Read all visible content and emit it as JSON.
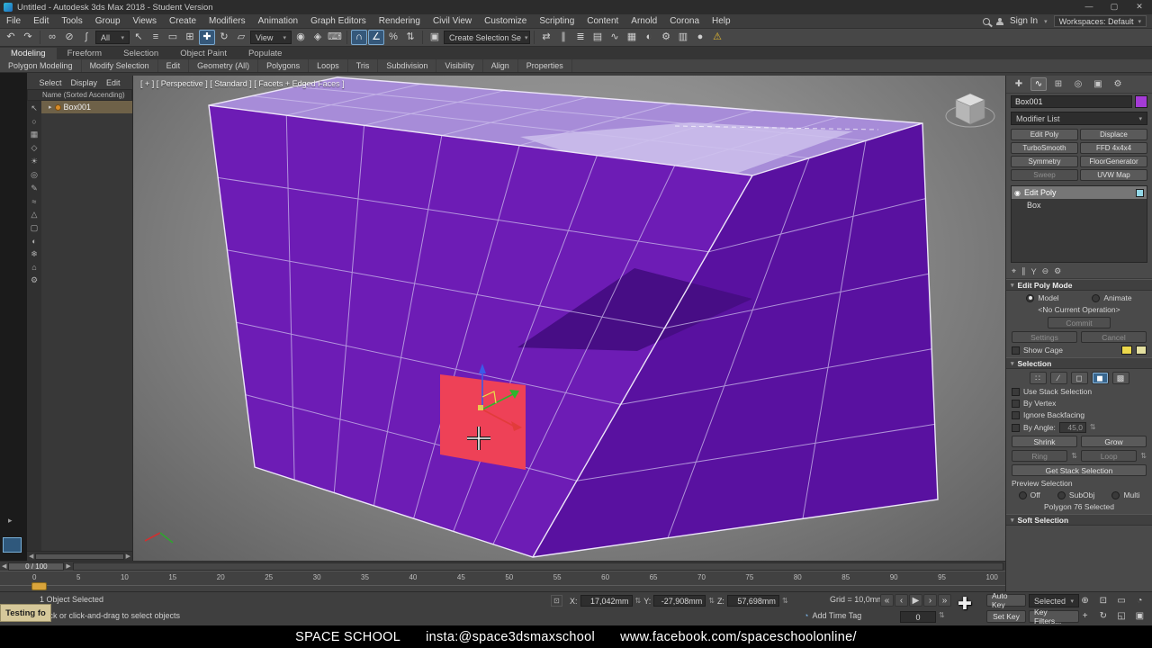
{
  "colors": {
    "box_front": "#6d1cb5",
    "box_side": "#5911a0",
    "box_top": "#a78cd8",
    "selected_polygon": "#ee4157",
    "highlight_blue": "#35587a",
    "object_swatch": "#a43bd6",
    "playhead_yellow": "#d9a43b"
  },
  "ui_glyphs": {
    "dropdown_arrow": "▾",
    "expander": "▸",
    "spinner": "⇅",
    "arrow_left": "◀",
    "arrow_right": "▶"
  },
  "title_bar": {
    "title": "Untitled - Autodesk 3ds Max 2018 - Student Version",
    "window_controls": [
      {
        "name": "minimize-button",
        "glyph": "—"
      },
      {
        "name": "maximize-button",
        "glyph": "▢"
      },
      {
        "name": "close-button",
        "glyph": "✕"
      }
    ]
  },
  "menu_bar": {
    "items": [
      "File",
      "Edit",
      "Tools",
      "Group",
      "Views",
      "Create",
      "Modifiers",
      "Animation",
      "Graph Editors",
      "Rendering",
      "Civil View",
      "Customize",
      "Scripting",
      "Content",
      "Arnold",
      "Corona",
      "Help"
    ],
    "sign_in": "Sign In",
    "workspaces": "Workspaces: Default"
  },
  "toolbar": {
    "history_icons": [
      {
        "name": "undo-icon",
        "glyph": "↶"
      },
      {
        "name": "redo-icon",
        "glyph": "↷"
      }
    ],
    "link_icons": [
      {
        "name": "select-and-link-icon",
        "glyph": "∞"
      },
      {
        "name": "unlink-selection-icon",
        "glyph": "⊘"
      },
      {
        "name": "bind-to-space-warp-icon",
        "glyph": "∫"
      }
    ],
    "selection_filter": "All",
    "select_icons": [
      {
        "name": "select-object-icon",
        "glyph": "↖"
      },
      {
        "name": "select-by-name-icon",
        "glyph": "≡"
      },
      {
        "name": "rectangular-selection-region-icon",
        "glyph": "▭"
      },
      {
        "name": "window-crossing-icon",
        "glyph": "⊞"
      }
    ],
    "transform_icons": [
      {
        "name": "select-and-move-icon",
        "glyph": "✚",
        "cls": "active"
      },
      {
        "name": "select-and-rotate-icon",
        "glyph": "↻"
      },
      {
        "name": "select-and-scale-icon",
        "glyph": "▱"
      }
    ],
    "ref_coord": "View",
    "pivot_icons": [
      {
        "name": "use-pivot-point-center-icon",
        "glyph": "◉"
      },
      {
        "name": "select-and-manipulate-icon",
        "glyph": "◈"
      },
      {
        "name": "keyboard-shortcut-override-icon",
        "glyph": "⌨"
      }
    ],
    "snap_icons": [
      {
        "name": "snaps-toggle-icon",
        "glyph": "∩",
        "cls": "active"
      },
      {
        "name": "angle-snap-icon",
        "glyph": "∠",
        "cls": "active"
      },
      {
        "name": "percent-snap-icon",
        "glyph": "%"
      },
      {
        "name": "spinner-snap-icon",
        "glyph": "⇅"
      }
    ],
    "named_set_icons": [
      {
        "name": "edit-named-selection-sets-icon",
        "glyph": "▣"
      }
    ],
    "selection_set_value": "Create Selection Se",
    "right_icons": [
      {
        "name": "mirror-icon",
        "glyph": "⇄"
      },
      {
        "name": "align-icon",
        "glyph": "∥"
      },
      {
        "name": "layer-manager-icon",
        "glyph": "≣"
      },
      {
        "name": "ribbon-toggle-icon",
        "glyph": "▤"
      },
      {
        "name": "curve-editor-icon",
        "glyph": "∿"
      },
      {
        "name": "schematic-view-icon",
        "glyph": "▦"
      },
      {
        "name": "material-editor-icon",
        "glyph": "◐"
      },
      {
        "name": "render-setup-icon",
        "glyph": "⚙"
      },
      {
        "name": "rendered-frame-window-icon",
        "glyph": "▥"
      },
      {
        "name": "render-production-icon",
        "glyph": "●"
      },
      {
        "name": "warning-icon",
        "glyph": "⚠",
        "cls": "warn"
      }
    ]
  },
  "ribbon": {
    "tabs": [
      {
        "label": "Modeling",
        "cls": "active"
      },
      {
        "label": "Freeform"
      },
      {
        "label": "Selection"
      },
      {
        "label": "Object Paint"
      },
      {
        "label": "Populate"
      }
    ],
    "sections": [
      "Polygon Modeling",
      "Modify Selection",
      "Edit",
      "Geometry (All)",
      "Polygons",
      "Loops",
      "Tris",
      "Subdivision",
      "Visibility",
      "Align",
      "Properties"
    ]
  },
  "scene_explorer": {
    "tabs": [
      {
        "name": "explorer-tab-select",
        "label": "Select"
      },
      {
        "name": "explorer-tab-display",
        "label": "Display"
      },
      {
        "name": "explorer-tab-edit",
        "label": "Edit"
      }
    ],
    "column_header": "Name (Sorted Ascending)",
    "left_icons": [
      {
        "name": "select-filter-icon",
        "glyph": "↖"
      },
      {
        "name": "display-all-icon",
        "glyph": "○"
      },
      {
        "name": "display-geometry-icon",
        "glyph": "▦"
      },
      {
        "name": "display-shapes-icon",
        "glyph": "◇"
      },
      {
        "name": "display-lights-icon",
        "glyph": "☀"
      },
      {
        "name": "display-cameras-icon",
        "glyph": "◎"
      },
      {
        "name": "display-helpers-icon",
        "glyph": "✎"
      },
      {
        "name": "display-spacewarps-icon",
        "glyph": "≈"
      },
      {
        "name": "display-bones-icon",
        "glyph": "△"
      },
      {
        "name": "display-containers-icon",
        "glyph": "▢"
      },
      {
        "name": "display-materials-icon",
        "glyph": "◐"
      },
      {
        "name": "display-frozen-icon",
        "glyph": "❄"
      },
      {
        "name": "display-hidden-icon",
        "glyph": "⌂"
      },
      {
        "name": "explorer-settings-icon",
        "glyph": "⚙"
      }
    ],
    "rows": [
      {
        "name": "Box001"
      }
    ]
  },
  "viewport": {
    "label": "[ + ] [ Perspective ] [ Standard ] [ Facets + Edged Faces ]"
  },
  "command_panel": {
    "tab_icons": [
      {
        "name": "create-tab-icon",
        "glyph": "✚"
      },
      {
        "name": "modify-tab-icon",
        "glyph": "∿",
        "cls": "active"
      },
      {
        "name": "hierarchy-tab-icon",
        "glyph": "⊞"
      },
      {
        "name": "motion-tab-icon",
        "glyph": "◎"
      },
      {
        "name": "display-tab-icon",
        "glyph": "▣"
      },
      {
        "name": "utilities-tab-icon",
        "glyph": "⚙"
      }
    ],
    "object_name": "Box001",
    "modifier_list_label": "Modifier List",
    "modifier_buttons": [
      {
        "name": "modifier-button-edit-poly",
        "label": "Edit Poly"
      },
      {
        "name": "modifier-button-displace",
        "label": "Displace"
      },
      {
        "name": "modifier-button-turbosmooth",
        "label": "TurboSmooth"
      },
      {
        "name": "modifier-button-ffd4x4x4",
        "label": "FFD 4x4x4"
      },
      {
        "name": "modifier-button-symmetry",
        "label": "Symmetry"
      },
      {
        "name": "modifier-button-floorgenerator",
        "label": "FloorGenerator"
      },
      {
        "name": "modifier-button-sweep",
        "label": "Sweep",
        "cls": "dim"
      },
      {
        "name": "modifier-button-uvw-map",
        "label": "UVW Map"
      }
    ],
    "stack_rows": [
      {
        "name": "Edit Poly",
        "icon": "◉"
      },
      {
        "name": "Box"
      }
    ],
    "stack_tool_icons": [
      {
        "name": "pin-stack-icon",
        "glyph": "⌖"
      },
      {
        "name": "show-end-result-icon",
        "glyph": "∥"
      },
      {
        "name": "make-unique-icon",
        "glyph": "Y"
      },
      {
        "name": "remove-modifier-icon",
        "glyph": "⊖"
      },
      {
        "name": "configure-modifier-sets-icon",
        "glyph": "⚙"
      }
    ],
    "edit_poly_mode": {
      "title": "Edit Poly Mode",
      "model_label": "Model",
      "animate_label": "Animate",
      "operation": "<No Current Operation>",
      "commit_label": "Commit",
      "settings_label": "Settings",
      "cancel_label": "Cancel",
      "show_cage_label": "Show Cage"
    },
    "selection": {
      "title": "Selection",
      "subobject_icons": [
        {
          "name": "vertex-subobject-icon",
          "glyph": "∷"
        },
        {
          "name": "edge-subobject-icon",
          "glyph": "∕"
        },
        {
          "name": "border-subobject-icon",
          "glyph": "◻"
        },
        {
          "name": "polygon-subobject-icon",
          "glyph": "◼",
          "cls": "active"
        },
        {
          "name": "element-subobject-icon",
          "glyph": "▩"
        }
      ],
      "checkboxes": [
        {
          "name": "use-stack-selection-checkbox",
          "label": "Use Stack Selection"
        },
        {
          "name": "by-vertex-checkbox",
          "label": "By Vertex"
        },
        {
          "name": "ignore-backfacing-checkbox",
          "label": "Ignore Backfacing"
        }
      ],
      "by_angle_label": "By Angle:",
      "by_angle_value": "45,0",
      "shrink_label": "Shrink",
      "grow_label": "Grow",
      "ring_label": "Ring",
      "loop_label": "Loop",
      "get_stack_label": "Get Stack Selection",
      "preview_label": "Preview Selection",
      "preview_options": [
        {
          "name": "preview-off-radio",
          "label": "Off",
          "cls": "on"
        },
        {
          "name": "preview-subobj-radio",
          "label": "SubObj"
        },
        {
          "name": "preview-multi-radio",
          "label": "Multi"
        }
      ],
      "status": "Polygon 76 Selected"
    },
    "soft_selection_title": "Soft Selection"
  },
  "time_slider": {
    "value": "0 / 100"
  },
  "timeline": {
    "ticks": [
      "0",
      "5",
      "10",
      "15",
      "20",
      "25",
      "30",
      "35",
      "40",
      "45",
      "50",
      "55",
      "60",
      "65",
      "70",
      "75",
      "80",
      "85",
      "90",
      "95",
      "100"
    ]
  },
  "status_bar": {
    "selection_status": "1 Object Selected",
    "prompt": "Click or click-and-drag to select objects",
    "absolute_mode_glyph": "⊡",
    "x_label": "X:",
    "x_value": "17,042mm",
    "y_label": "Y:",
    "y_value": "-27,908mm",
    "z_label": "Z:",
    "z_value": "57,698mm",
    "grid_label": "Grid = 10,0mm",
    "time_tag_glyph": "◔",
    "add_time_tag": "Add Time Tag",
    "playback_icons": [
      {
        "name": "go-to-start-icon",
        "glyph": "«"
      },
      {
        "name": "previous-frame-icon",
        "glyph": "‹"
      },
      {
        "name": "play-icon",
        "glyph": "▶"
      },
      {
        "name": "next-frame-icon",
        "glyph": "›"
      },
      {
        "name": "go-to-end-icon",
        "glyph": "»"
      }
    ],
    "auto_key_label": "Auto Key",
    "selected_label": "Selected",
    "set_key_label": "Set Key",
    "key_filters_label": "Key Filters...",
    "frame_value": "0",
    "nav_icons": [
      {
        "name": "zoom-icon",
        "glyph": "⊕"
      },
      {
        "name": "zoom-all-icon",
        "glyph": "⊡"
      },
      {
        "name": "zoom-extents-icon",
        "glyph": "▭"
      },
      {
        "name": "field-of-view-icon",
        "glyph": "◔"
      },
      {
        "name": "pan-icon",
        "glyph": "+"
      },
      {
        "name": "orbit-icon",
        "glyph": "↻"
      },
      {
        "name": "region-zoom-icon",
        "glyph": "◱"
      },
      {
        "name": "maximize-viewport-icon",
        "glyph": "▣"
      }
    ]
  },
  "overlay": {
    "badge": "Testing fo",
    "cursor_glyph": "✚",
    "caption_parts": [
      "SPACE SCHOOL",
      "insta:@space3dsmaxschool",
      "www.facebook.com/spaceschoolonline/"
    ]
  }
}
